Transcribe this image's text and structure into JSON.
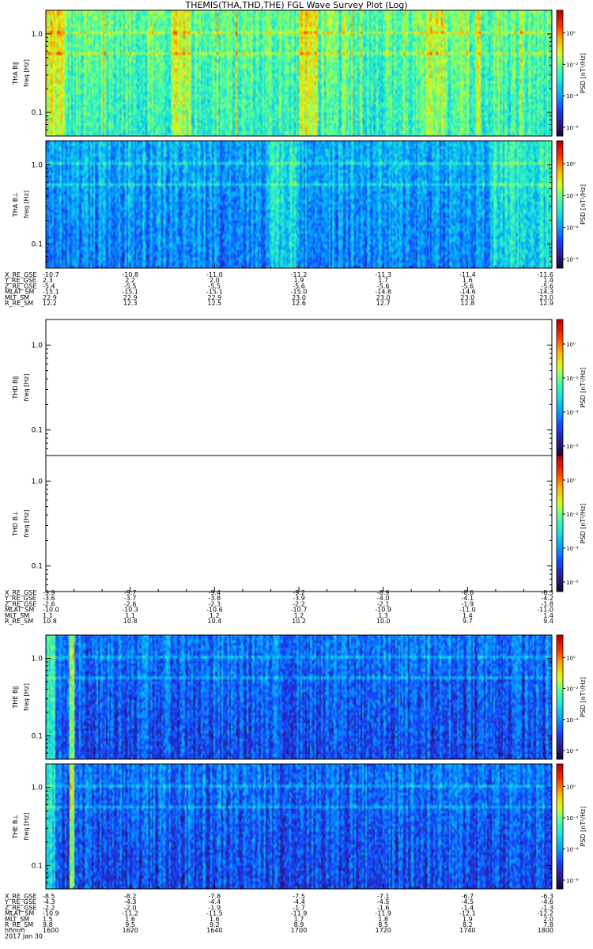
{
  "title": "THEMIS(THA,THD,THE) FGL Wave Survey Plot (Log)",
  "date_label": "2017 Jan 30",
  "chart_data": {
    "type": "heatmap",
    "yscale": "log",
    "ylim": [
      0.05,
      2.0
    ],
    "ytick_labels": [
      "1.0",
      "0.1"
    ],
    "colorbar_label": "PSD [nT²/Hz]",
    "colorbar_ticks": [
      "10⁰",
      "10⁻²",
      "10⁻⁴",
      "10⁻⁶"
    ],
    "colormap": [
      "#1a0026",
      "#2a1a8a",
      "#1a3fff",
      "#00a0ff",
      "#18e0e0",
      "#50ff9a",
      "#d8ff20",
      "#ffb000",
      "#ff3000",
      "#c00000"
    ],
    "panels": [
      {
        "probe": "THA",
        "component": "B∥",
        "label": "THA B∥",
        "ylabel": "freq [Hz]",
        "has_data": true,
        "level": "high"
      },
      {
        "probe": "THA",
        "component": "B⊥",
        "label": "THA B⊥",
        "ylabel": "freq [Hz]",
        "has_data": true,
        "level": "mid"
      },
      {
        "probe": "THD",
        "component": "B∥",
        "label": "THD B∥",
        "ylabel": "freq [Hz]",
        "has_data": false
      },
      {
        "probe": "THD",
        "component": "B⊥",
        "label": "THD B⊥",
        "ylabel": "freq [Hz]",
        "has_data": false
      },
      {
        "probe": "THE",
        "component": "B∥",
        "label": "THE B∥",
        "ylabel": "freq [Hz]",
        "has_data": true,
        "level": "low"
      },
      {
        "probe": "THE",
        "component": "B⊥",
        "label": "THE B⊥",
        "ylabel": "freq [Hz]",
        "has_data": true,
        "level": "low"
      }
    ],
    "ephemeris": [
      {
        "probe": "THA",
        "rows": [
          {
            "name": "X_RE_GSE",
            "values": [
              "-10.7",
              "-10.8",
              "-11.0",
              "-11.2",
              "-11.3",
              "-11.4",
              "-11.6"
            ]
          },
          {
            "name": "Y_RE_GSE",
            "values": [
              "2.3",
              "2.2",
              "2.0",
              "1.9",
              "1.7",
              "1.6",
              "1.4"
            ]
          },
          {
            "name": "Z_RE_GSE",
            "values": [
              "-5.4",
              "-5.5",
              "-5.5",
              "-5.6",
              "-5.6",
              "-5.6",
              "-5.6"
            ]
          },
          {
            "name": "MLAT_SM",
            "values": [
              "-15.1",
              "-15.1",
              "-15.1",
              "-15.0",
              "-14.8",
              "-14.6",
              "-14.3"
            ]
          },
          {
            "name": "MLT_SM",
            "values": [
              "22.9",
              "22.9",
              "22.9",
              "23.0",
              "23.0",
              "23.0",
              "23.0"
            ]
          },
          {
            "name": "R_RE_SM",
            "values": [
              "12.2",
              "12.3",
              "12.5",
              "12.6",
              "12.7",
              "12.8",
              "12.9"
            ]
          }
        ]
      },
      {
        "probe": "THD",
        "rows": [
          {
            "name": "X_RE_GSE",
            "values": [
              "-9.9",
              "-9.7",
              "-9.4",
              "-9.2",
              "-8.9",
              "-8.6",
              "-8.3"
            ]
          },
          {
            "name": "Y_RE_GSE",
            "values": [
              "-3.6",
              "-3.7",
              "-3.8",
              "-3.9",
              "-4.0",
              "-4.1",
              "-4.2"
            ]
          },
          {
            "name": "Z_RE_GSE",
            "values": [
              "-2.6",
              "-2.6",
              "-2.3",
              "-2.2",
              "-2.1",
              "-1.9",
              "-1.8"
            ]
          },
          {
            "name": "MLAT_SM",
            "values": [
              "-10.0",
              "-10.3",
              "-10.6",
              "-10.7",
              "-10.9",
              "-11.0",
              "-11.0"
            ]
          },
          {
            "name": "MLT_SM",
            "values": [
              "1.1",
              "1.1",
              "1.2",
              "1.2",
              "1.3",
              "1.4",
              "1.4"
            ]
          },
          {
            "name": "R_RE_SM",
            "values": [
              "10.8",
              "10.8",
              "10.4",
              "10.2",
              "10.0",
              "9.7",
              "9.4"
            ]
          }
        ]
      },
      {
        "probe": "THE",
        "rows": [
          {
            "name": "X_RE_GSE",
            "values": [
              "-8.5",
              "-8.2",
              "-7.8",
              "-7.5",
              "-7.1",
              "-6.7",
              "-6.3"
            ]
          },
          {
            "name": "Y_RE_GSE",
            "values": [
              "-4.3",
              "-4.3",
              "-4.4",
              "-4.4",
              "-4.5",
              "-4.5",
              "-4.6"
            ]
          },
          {
            "name": "Z_RE_GSE",
            "values": [
              "-2.2",
              "-2.0",
              "-1.9",
              "-1.7",
              "-1.6",
              "-1.4",
              "-1.3"
            ]
          },
          {
            "name": "MLAT_SM",
            "values": [
              "-10.9",
              "-11.2",
              "-11.5",
              "-11.9",
              "-11.9",
              "-12.1",
              "-12.2"
            ]
          },
          {
            "name": "MLT_SM",
            "values": [
              "1.5",
              "1.6",
              "1.6",
              "1.7",
              "1.8",
              "1.9",
              "2.0"
            ]
          },
          {
            "name": "R_RE_SM",
            "values": [
              "9.8",
              "9.5",
              "9.2",
              "8.9",
              "8.5",
              "8.2",
              "7.8"
            ]
          },
          {
            "name": "hhmm",
            "values": [
              "1600",
              "1620",
              "1640",
              "1700",
              "1720",
              "1740",
              "1800"
            ]
          }
        ]
      }
    ]
  }
}
